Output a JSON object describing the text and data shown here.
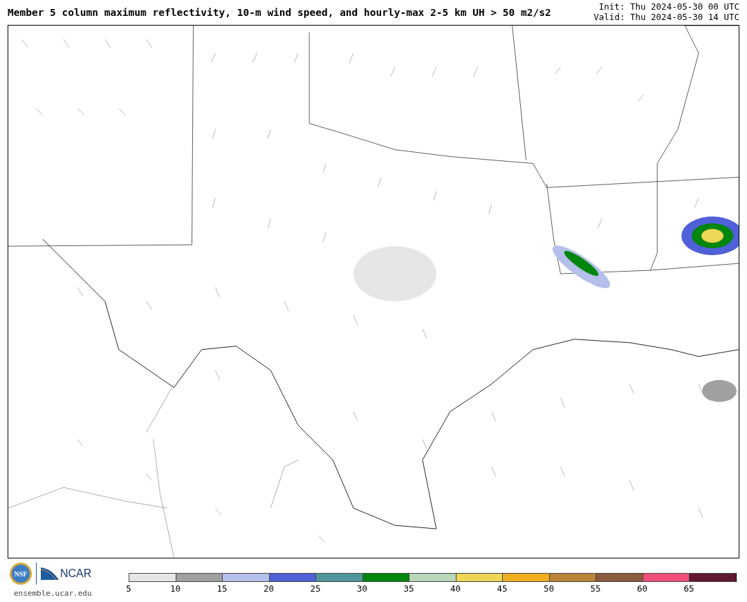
{
  "title": "Member 5 column maximum reflectivity, 10-m wind speed, and hourly-max 2-5 km UH > 50 m2/s2",
  "init": "Init: Thu 2024-05-30 00 UTC",
  "valid": "Valid: Thu 2024-05-30 14 UTC",
  "logos": {
    "nsf": "NSF",
    "ncar": "NCAR",
    "site": "ensemble.ucar.edu"
  },
  "colorbar": [
    {
      "color": "#e6e6e6",
      "tick": "5"
    },
    {
      "color": "#a0a0a0",
      "tick": "10"
    },
    {
      "color": "#b4c0ea",
      "tick": "15"
    },
    {
      "color": "#5060d8",
      "tick": "20"
    },
    {
      "color": "#4f979d",
      "tick": "25"
    },
    {
      "color": "#00860c",
      "tick": "30"
    },
    {
      "color": "#b8d6b8",
      "tick": "35"
    },
    {
      "color": "#eed656",
      "tick": "40"
    },
    {
      "color": "#eeae20",
      "tick": "45"
    },
    {
      "color": "#bb8538",
      "tick": "50"
    },
    {
      "color": "#8a5a40",
      "tick": "55"
    },
    {
      "color": "#f05078",
      "tick": "60"
    },
    {
      "color": "#60172f",
      "tick": "65"
    }
  ]
}
